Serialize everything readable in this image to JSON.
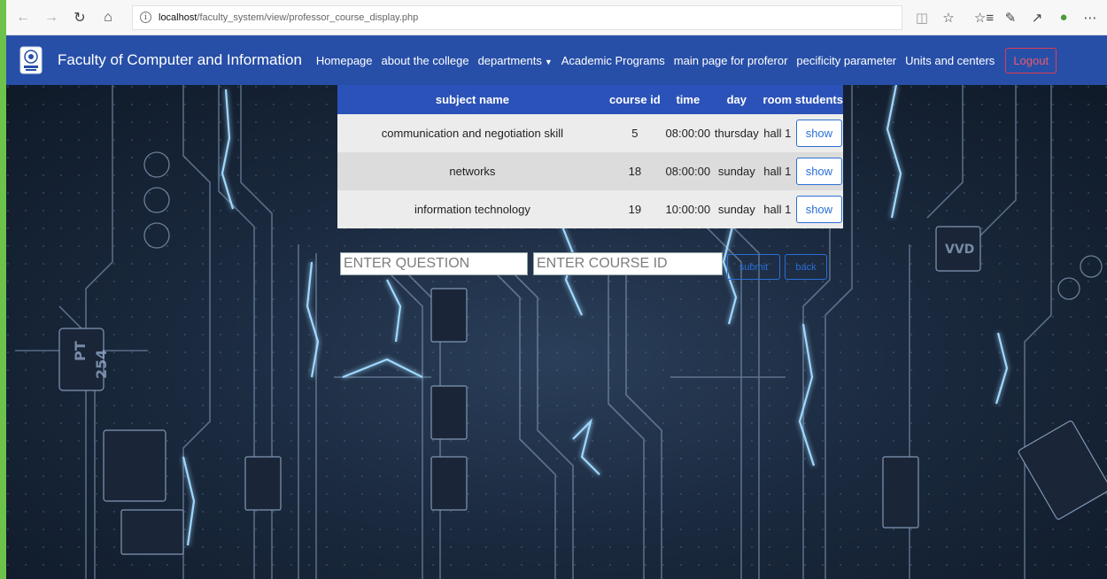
{
  "browser": {
    "url_host": "localhost",
    "url_path": "/faculty_system/view/professor_course_display.php"
  },
  "navbar": {
    "brand": "Faculty of Computer and Information",
    "links": [
      {
        "label": "Homepage"
      },
      {
        "label": "about the college"
      },
      {
        "label": "departments"
      },
      {
        "label": "Academic Programs"
      },
      {
        "label": "main page for proferor"
      },
      {
        "label": "pecificity parameter"
      },
      {
        "label": "Units and centers"
      }
    ],
    "logout_label": "Logout"
  },
  "table": {
    "headers": [
      "subject name",
      "course id",
      "time",
      "day",
      "room",
      "students"
    ],
    "rows": [
      {
        "subject": "communication and negotiation skill",
        "course_id": "5",
        "time": "08:00:00",
        "day": "thursday",
        "room": "hall 1",
        "action": "show"
      },
      {
        "subject": "networks",
        "course_id": "18",
        "time": "08:00:00",
        "day": "sunday",
        "room": "hall 1",
        "action": "show"
      },
      {
        "subject": "information technology",
        "course_id": "19",
        "time": "10:00:00",
        "day": "sunday",
        "room": "hall 1",
        "action": "show"
      }
    ]
  },
  "form": {
    "question_placeholder": "ENTER QUESTION",
    "course_id_placeholder": "ENTER COURSE ID",
    "submit_label": "submit",
    "back_label": "back"
  },
  "icons": {
    "back": "back-arrow-icon",
    "forward": "forward-arrow-icon",
    "refresh": "refresh-icon",
    "home": "home-icon",
    "info": "info-icon",
    "reader": "reading-view-icon",
    "favorite": "star-icon",
    "favorites_list": "favorites-list-icon",
    "pen": "pen-icon",
    "share": "share-icon",
    "extension": "extension-icon",
    "more": "more-icon"
  },
  "colors": {
    "navbar": "#274fa8",
    "table_header": "#2b52b8",
    "accent_green": "#6cc24a",
    "logout": "#e03a52",
    "button_blue": "#2a6fd6"
  }
}
